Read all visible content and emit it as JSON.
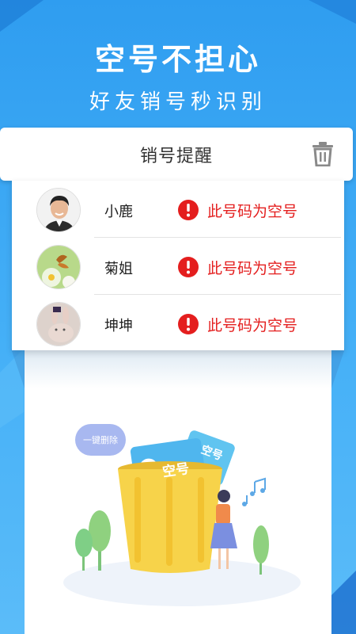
{
  "hero": {
    "headline": "空号不担心",
    "subline": "好友销号秒识别"
  },
  "header": {
    "title": "销号提醒",
    "delete_icon": "trash-icon"
  },
  "contacts": [
    {
      "name": "小鹿",
      "status": "此号码为空号",
      "avatar": "avatar-man"
    },
    {
      "name": "菊姐",
      "status": "此号码为空号",
      "avatar": "avatar-butterfly"
    },
    {
      "name": "坤坤",
      "status": "此号码为空号",
      "avatar": "avatar-rabbit"
    }
  ],
  "illustration": {
    "bubble": "一键删除",
    "card_label": "空号",
    "card_label2": "空号"
  },
  "colors": {
    "background": "#3ea8f5",
    "warning": "#e41e1e",
    "bin": "#f7d34a"
  }
}
